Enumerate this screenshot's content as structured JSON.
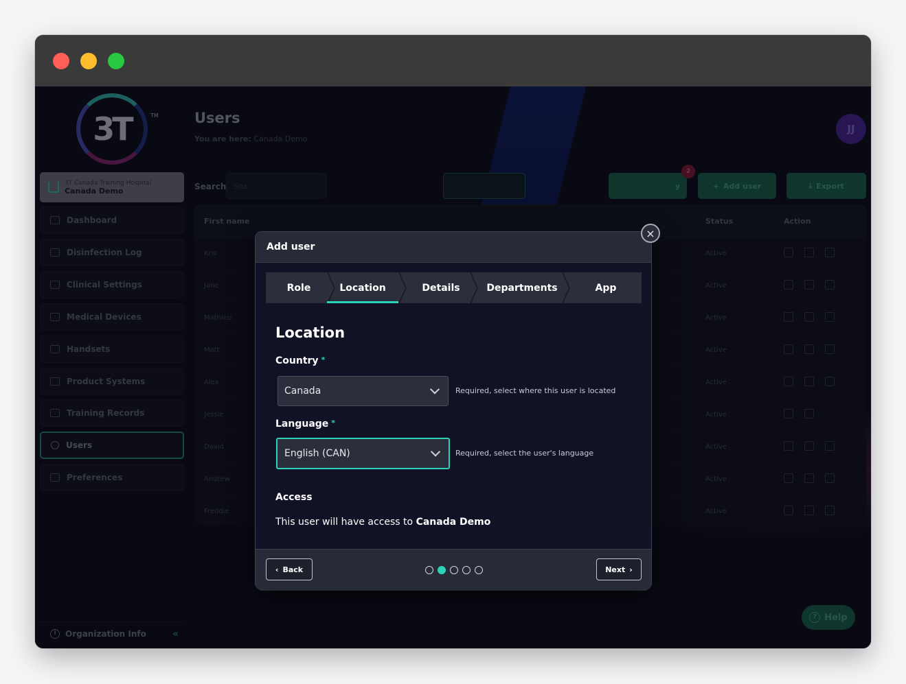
{
  "app": {
    "logo_text": "3T",
    "logo_tm": "TM",
    "org": {
      "sub": "3T Canada Training Hospital",
      "main": "Canada Demo"
    },
    "nav": [
      {
        "label": "Dashboard",
        "icon": "dashboard-icon"
      },
      {
        "label": "Disinfection Log",
        "icon": "document-icon"
      },
      {
        "label": "Clinical Settings",
        "icon": "clinical-icon"
      },
      {
        "label": "Medical Devices",
        "icon": "device-icon"
      },
      {
        "label": "Handsets",
        "icon": "handset-icon"
      },
      {
        "label": "Product Systems",
        "icon": "list-icon"
      },
      {
        "label": "Training Records",
        "icon": "list-check-icon"
      },
      {
        "label": "Users",
        "icon": "users-icon",
        "active": true
      },
      {
        "label": "Preferences",
        "icon": "gear-icon"
      }
    ],
    "org_info": "Organization Info",
    "collapse": "«",
    "page_title": "Users",
    "breadcrumb": {
      "prefix": "You are here:",
      "value": "Canada Demo"
    },
    "avatar": "JJ",
    "search": {
      "label": "Search",
      "placeholder": "Sea"
    },
    "toolbar": {
      "filter_partial": "y",
      "add_user": "Add user",
      "export": "Export",
      "badge": "2"
    },
    "table": {
      "headers": [
        "First name",
        "Status",
        "Action"
      ],
      "rows": [
        {
          "first": "Kris",
          "status": "Active"
        },
        {
          "first": "Jane",
          "status": "Active"
        },
        {
          "first": "Mathieu",
          "status": "Active"
        },
        {
          "first": "Matt",
          "status": "Active"
        },
        {
          "first": "Alex",
          "status": "Active"
        },
        {
          "first": "Jessie",
          "status": "Active"
        },
        {
          "first": "David",
          "status": "Active"
        },
        {
          "first": "Andrew",
          "status": "Active"
        },
        {
          "first": "Freddie",
          "status": "Active"
        }
      ]
    },
    "help": "Help"
  },
  "modal": {
    "title": "Add user",
    "close": "×",
    "steps": [
      "Role",
      "Location",
      "Details",
      "Departments",
      "App"
    ],
    "active_step": 1,
    "section_title": "Location",
    "country": {
      "label": "Country",
      "required": "*",
      "value": "Canada",
      "hint": "Required, select where this user is located"
    },
    "language": {
      "label": "Language",
      "required": "*",
      "value": "English (CAN)",
      "hint": "Required, select the user's language"
    },
    "access": {
      "label": "Access",
      "text": "This user will have access to",
      "org": "Canada Demo"
    },
    "back": "Back",
    "next": "Next",
    "progress": {
      "total": 5,
      "current": 2
    }
  },
  "colors": {
    "accent": "#2ed3b7",
    "modal_bg": "#111225",
    "header_bg": "#272b38"
  }
}
